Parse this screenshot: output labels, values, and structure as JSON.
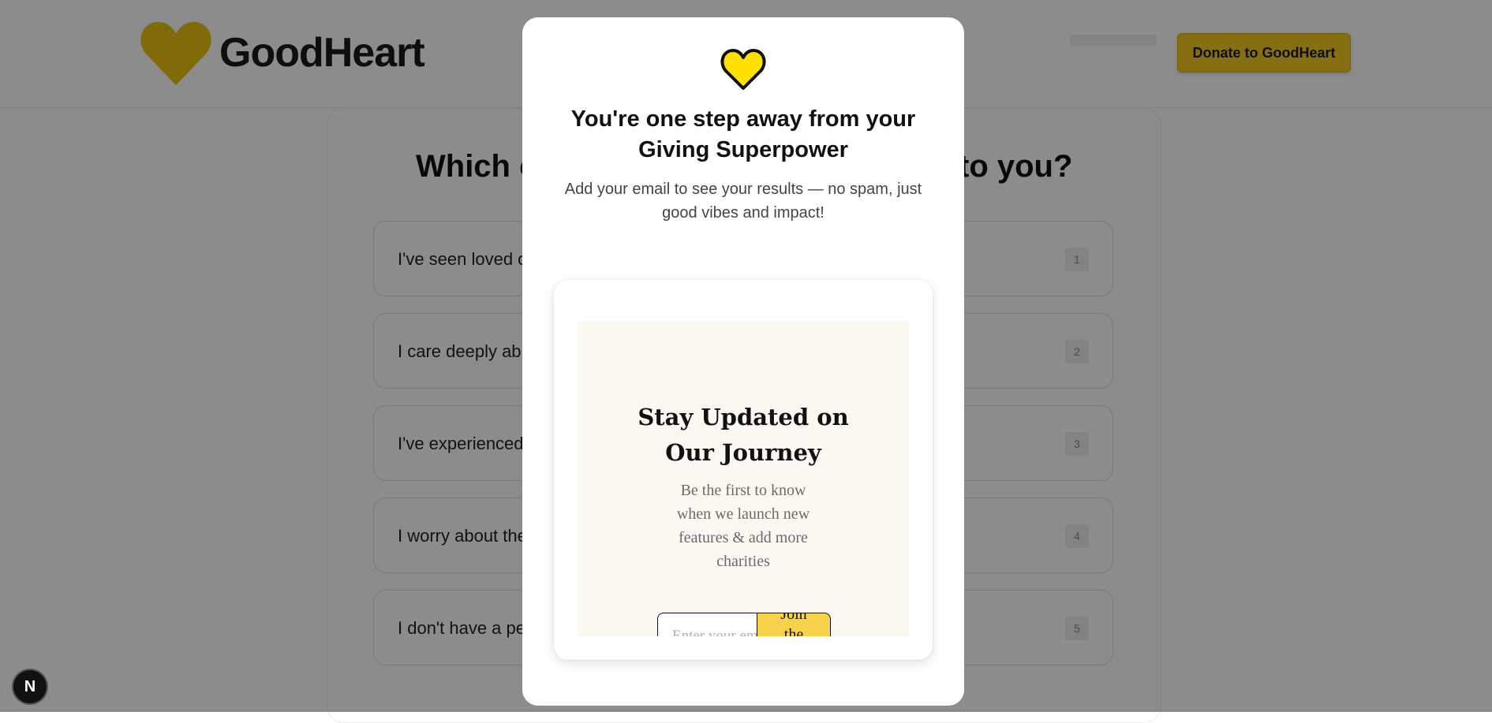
{
  "header": {
    "brand_name": "GoodHeart",
    "donate_label": "Donate to GoodHeart"
  },
  "quiz": {
    "question": "Which cause feels closest to you?",
    "question_visible_left": "Which c",
    "question_visible_right": "to you?",
    "options": [
      {
        "label": "I've seen loved o",
        "number": "1"
      },
      {
        "label": "I care deeply ab",
        "number": "2"
      },
      {
        "label": "I've experienced",
        "number": "3"
      },
      {
        "label": "I worry about the",
        "number": "4"
      },
      {
        "label": "I don't have a pe",
        "number": "5"
      }
    ]
  },
  "modal": {
    "title": "You're one step away from your Giving Superpower",
    "subtitle": "Add your email to see your results — no spam, just good vibes and impact!",
    "newsletter": {
      "title": "Stay Updated on Our Journey",
      "description": "Be the first to know when we launch new features & add more charities",
      "email_placeholder": "Enter your email",
      "join_label": "Join the"
    }
  },
  "dev_badge": "N",
  "colors": {
    "brand_yellow": "#f4c824",
    "heart_icon_yellow": "#ffe000",
    "newsletter_bg": "#fbf8f2",
    "join_button": "#f8d24a"
  }
}
